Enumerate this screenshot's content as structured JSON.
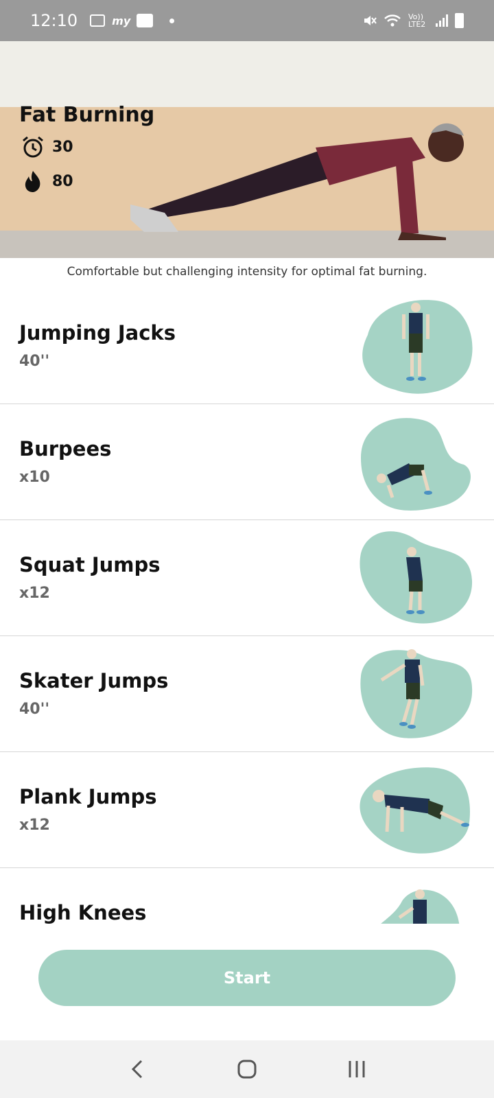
{
  "status_bar": {
    "time": "12:10",
    "network": "Vo)) LTE2"
  },
  "hero": {
    "title": "Fat Burning",
    "duration": "30",
    "calories": "80"
  },
  "description": "Comfortable but challenging intensity for optimal fat burning.",
  "exercises": [
    {
      "name": "Jumping Jacks",
      "amount": "40''"
    },
    {
      "name": "Burpees",
      "amount": "x10"
    },
    {
      "name": "Squat Jumps",
      "amount": "x12"
    },
    {
      "name": "Skater Jumps",
      "amount": "40''"
    },
    {
      "name": "Plank Jumps",
      "amount": "x12"
    },
    {
      "name": "High Knees",
      "amount": ""
    }
  ],
  "start_label": "Start",
  "colors": {
    "accent": "#a3d2c3",
    "blob": "#a5d3c5",
    "status_bar": "#9a9a9a"
  }
}
